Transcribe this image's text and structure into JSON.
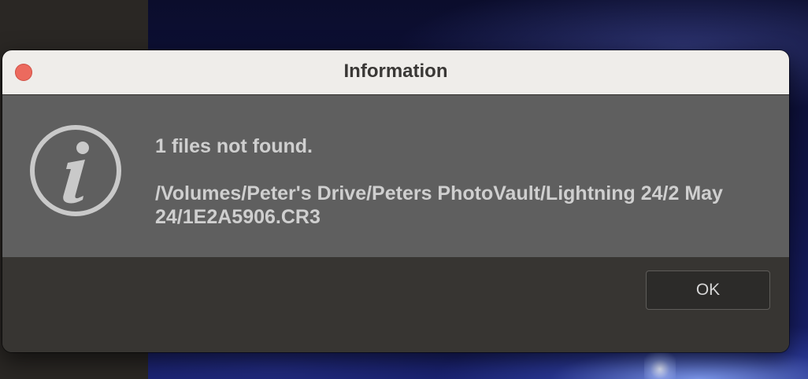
{
  "dialog": {
    "title": "Information",
    "message_line1": "1 files not found.",
    "message_path": "/Volumes/Peter's Drive/Peters PhotoVault/Lightning 24/2 May 24/1E2A5906.CR3",
    "ok_label": "OK",
    "icon": "info-icon"
  },
  "colors": {
    "titlebar": "#efedea",
    "body": "#5f5f5f",
    "footer": "#373532",
    "close_button": "#ec6a5e",
    "text": "#cfcfcf"
  }
}
